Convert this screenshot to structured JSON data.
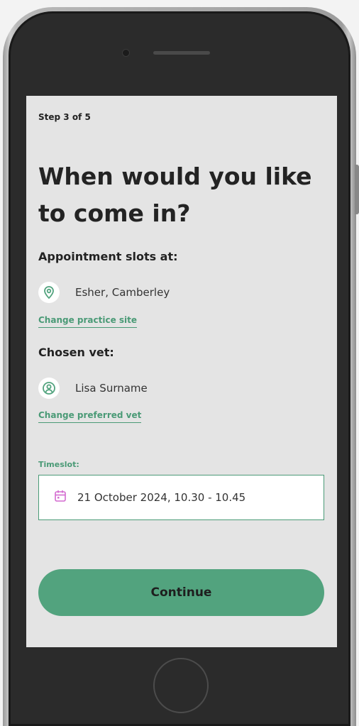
{
  "form": {
    "step": "Step 3 of 5",
    "title": "When would you like to come in?",
    "slots_label": "Appointment slots at:",
    "site_name": "Esher, Camberley",
    "change_site_link": "Change practice site",
    "vet_label": "Chosen vet:",
    "vet_name": "Lisa Surname",
    "change_vet_link": "Change preferred vet",
    "timeslot_label": "Timeslot:",
    "timeslot_value": "21 October 2024, 10.30 - 10.45",
    "continue_label": "Continue"
  },
  "colors": {
    "accent": "#52a37e",
    "link": "#4a9a76",
    "calendar_icon": "#d46bd0",
    "screen_bg": "#e4e4e4"
  },
  "icons": {
    "site": "location-pin-icon",
    "vet": "person-icon",
    "timeslot": "calendar-icon"
  }
}
